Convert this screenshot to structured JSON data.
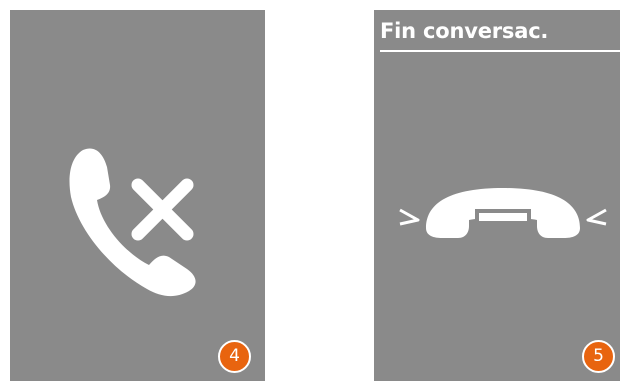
{
  "panels": [
    {
      "title": "",
      "icon": "call-rejected-icon",
      "step": "4"
    },
    {
      "title": "Fin conversac.",
      "icon": "hang-up-icon",
      "step": "5"
    }
  ],
  "colors": {
    "panel_background": "#8a8a8a",
    "icon": "#ffffff",
    "badge": "#e8640f"
  }
}
